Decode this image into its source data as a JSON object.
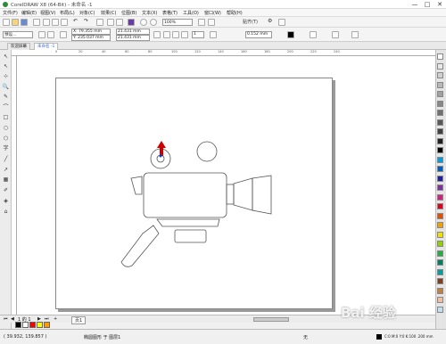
{
  "window": {
    "title": "CorelDRAW X8 (64-Bit) - 未命名 -1",
    "minimize": "—",
    "maximize": "□",
    "close": "✕"
  },
  "menu": [
    "文件(F)",
    "编辑(E)",
    "视图(V)",
    "布局(L)",
    "对象(C)",
    "效果(C)",
    "位图(B)",
    "文本(X)",
    "表格(T)",
    "工具(O)",
    "窗口(W)",
    "帮助(H)"
  ],
  "toolbar1": {
    "zoom": "100%",
    "snap_label": "贴齐(T)"
  },
  "toolbar2": {
    "preset": "预设...",
    "x": "X: 79.355 mm",
    "y": "Y: 235.037 mm",
    "w": "21.431 mm",
    "h": "21.431 mm",
    "copies": "1",
    "outline": "0.152 mm"
  },
  "tabs": [
    {
      "label": "欢迎屏幕"
    },
    {
      "label": "未命名 -1"
    }
  ],
  "ruler": {
    "ticks": [
      "0",
      "20",
      "40",
      "60",
      "80",
      "100",
      "120",
      "140",
      "160",
      "180",
      "200",
      "220",
      "240"
    ]
  },
  "tools": [
    "↖",
    "↖",
    "⊹",
    "🔍",
    "✎",
    "⌒",
    "□",
    "○",
    "⬡",
    "字",
    "╱",
    "↗",
    "▦",
    "✐",
    "◈",
    "⌂"
  ],
  "colors": {
    "accent": "#3c6dc9",
    "selection_arrow": "#cc0000",
    "page_shadow": "#999999"
  },
  "palette": [
    "#ffffff",
    "#e8e8e8",
    "#d0d0d0",
    "#b8b8b8",
    "#a0a0a0",
    "#888888",
    "#707070",
    "#585858",
    "#404040",
    "#202020",
    "#000000",
    "#00a0e0",
    "#0060c0",
    "#2020a0",
    "#8030a0",
    "#d02080",
    "#e00020",
    "#e05000",
    "#f0a000",
    "#f0e000",
    "#90d000",
    "#20b040",
    "#008060",
    "#00a0a0",
    "#804020",
    "#c08040",
    "#f0c0a0",
    "#c0e0f0"
  ],
  "page_nav": {
    "counter": "1 的 1",
    "page_tab": "页1"
  },
  "bottom_colors": [
    "#000000",
    "#ffffff",
    "#ff0000",
    "#ffff00",
    "#ff9900"
  ],
  "status": {
    "coords": "( 39.932, 139.857 )",
    "layer": "椭圆图形 于 图层1",
    "color": "C:0 M:0 Y:0 K:100  .200 mm",
    "fill": "无"
  },
  "watermark": "Bai 经验"
}
